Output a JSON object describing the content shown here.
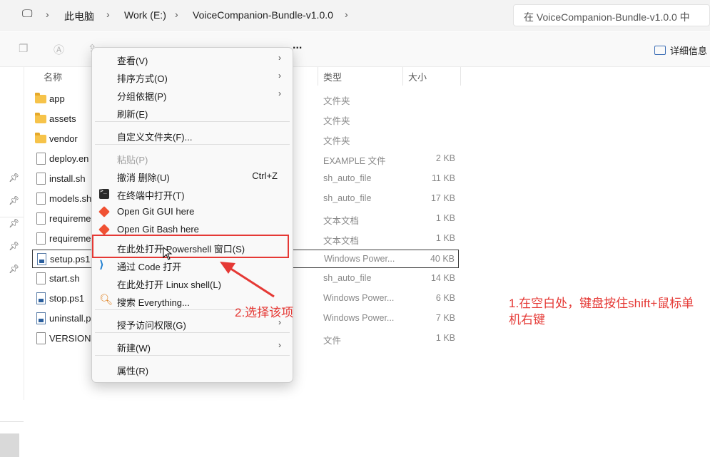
{
  "address_bar": {
    "breadcrumbs": [
      "此电脑",
      "Work (E:)",
      "VoiceCompanion-Bundle-v1.0.0"
    ],
    "search_placeholder": "在 VoiceCompanion-Bundle-v1.0.0 中"
  },
  "toolbar": {
    "details_label": "详细信息",
    "more_label": "..."
  },
  "columns": {
    "name": "名称",
    "type": "类型",
    "size": "大小"
  },
  "files": [
    {
      "name": "app",
      "type": "文件夹",
      "size": "",
      "icon": "folder-icon"
    },
    {
      "name": "assets",
      "type": "文件夹",
      "size": "",
      "icon": "folder-icon"
    },
    {
      "name": "vendor",
      "type": "文件夹",
      "size": "",
      "icon": "folder-icon"
    },
    {
      "name": "deploy.en",
      "type": "EXAMPLE 文件",
      "size": "2 KB",
      "icon": "file-icon"
    },
    {
      "name": "install.sh",
      "type": "sh_auto_file",
      "size": "11 KB",
      "icon": "file-icon"
    },
    {
      "name": "models.sh",
      "type": "sh_auto_file",
      "size": "17 KB",
      "icon": "file-icon"
    },
    {
      "name": "requireme",
      "type": "文本文档",
      "size": "1 KB",
      "icon": "text-file-icon"
    },
    {
      "name": "requireme",
      "type": "文本文档",
      "size": "1 KB",
      "icon": "text-file-icon"
    },
    {
      "name": "setup.ps1",
      "type": "Windows Power...",
      "size": "40 KB",
      "icon": "powershell-file-icon"
    },
    {
      "name": "start.sh",
      "type": "sh_auto_file",
      "size": "14 KB",
      "icon": "file-icon"
    },
    {
      "name": "stop.ps1",
      "type": "Windows Power...",
      "size": "6 KB",
      "icon": "powershell-file-icon"
    },
    {
      "name": "uninstall.p",
      "type": "Windows Power...",
      "size": "7 KB",
      "icon": "powershell-file-icon"
    },
    {
      "name": "VERSION",
      "type": "文件",
      "size": "1 KB",
      "icon": "file-icon"
    }
  ],
  "context_menu": {
    "items": [
      {
        "label": "查看(V)",
        "submenu": true
      },
      {
        "label": "排序方式(O)",
        "submenu": true
      },
      {
        "label": "分组依据(P)",
        "submenu": true
      },
      {
        "label": "刷新(E)"
      },
      {
        "label": "自定义文件夹(F)..."
      },
      {
        "label": "粘贴(P)",
        "disabled": true
      },
      {
        "label": "撤消 删除(U)",
        "shortcut": "Ctrl+Z"
      },
      {
        "label": "在终端中打开(T)",
        "icon": "terminal-icon"
      },
      {
        "label": "Open Git GUI here",
        "icon": "git-icon"
      },
      {
        "label": "Open Git Bash here",
        "icon": "git-icon"
      },
      {
        "label": "在此处打开 Powershell 窗口(S)"
      },
      {
        "label": "通过 Code 打开",
        "icon": "vscode-icon"
      },
      {
        "label": "在此处打开 Linux shell(L)"
      },
      {
        "label": "搜索 Everything...",
        "icon": "everything-search-icon"
      },
      {
        "label": "授予访问权限(G)",
        "submenu": true
      },
      {
        "label": "新建(W)",
        "submenu": true
      },
      {
        "label": "属性(R)"
      }
    ]
  },
  "annotations": {
    "step1": "1.在空白处，键盘按住shift+鼠标单机右键",
    "step2": "2.选择该项",
    "color": "#e53935"
  }
}
